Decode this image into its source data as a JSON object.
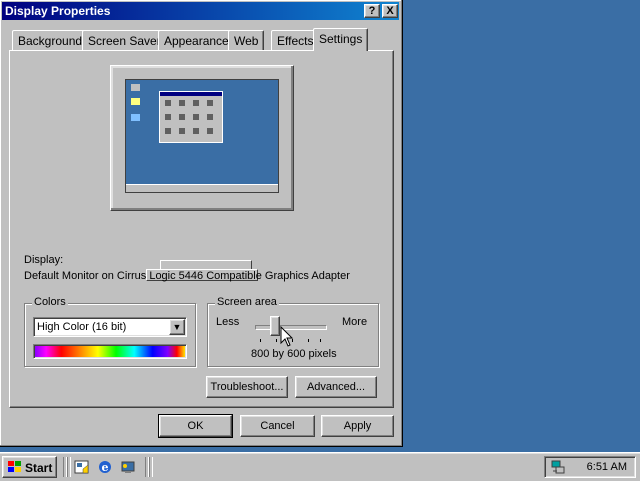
{
  "window": {
    "title": "Display Properties",
    "help_glyph": "?",
    "close_glyph": "X"
  },
  "tabs": [
    {
      "label": "Background"
    },
    {
      "label": "Screen Saver"
    },
    {
      "label": "Appearance"
    },
    {
      "label": "Web"
    },
    {
      "label": "Effects"
    },
    {
      "label": "Settings",
      "active": true
    }
  ],
  "display": {
    "label": "Display:",
    "description": "Default Monitor on Cirrus Logic 5446 Compatible Graphics Adapter"
  },
  "colors_group": {
    "title": "Colors",
    "selected": "High Color (16 bit)"
  },
  "screen_area_group": {
    "title": "Screen area",
    "less_label": "Less",
    "more_label": "More",
    "resolution": "800 by 600 pixels"
  },
  "panel_buttons": {
    "troubleshoot": "Troubleshoot...",
    "advanced": "Advanced..."
  },
  "dialog_buttons": {
    "ok": "OK",
    "cancel": "Cancel",
    "apply": "Apply"
  },
  "taskbar": {
    "start_label": "Start",
    "clock": "6:51 AM",
    "quick_launch": [
      "desktop-icon",
      "internet-explorer-icon",
      "channels-icon"
    ]
  },
  "colors": {
    "desktop": "#3a6ea5",
    "title_start": "#000080",
    "title_end": "#1084d0",
    "face": "#c0c0c0"
  }
}
